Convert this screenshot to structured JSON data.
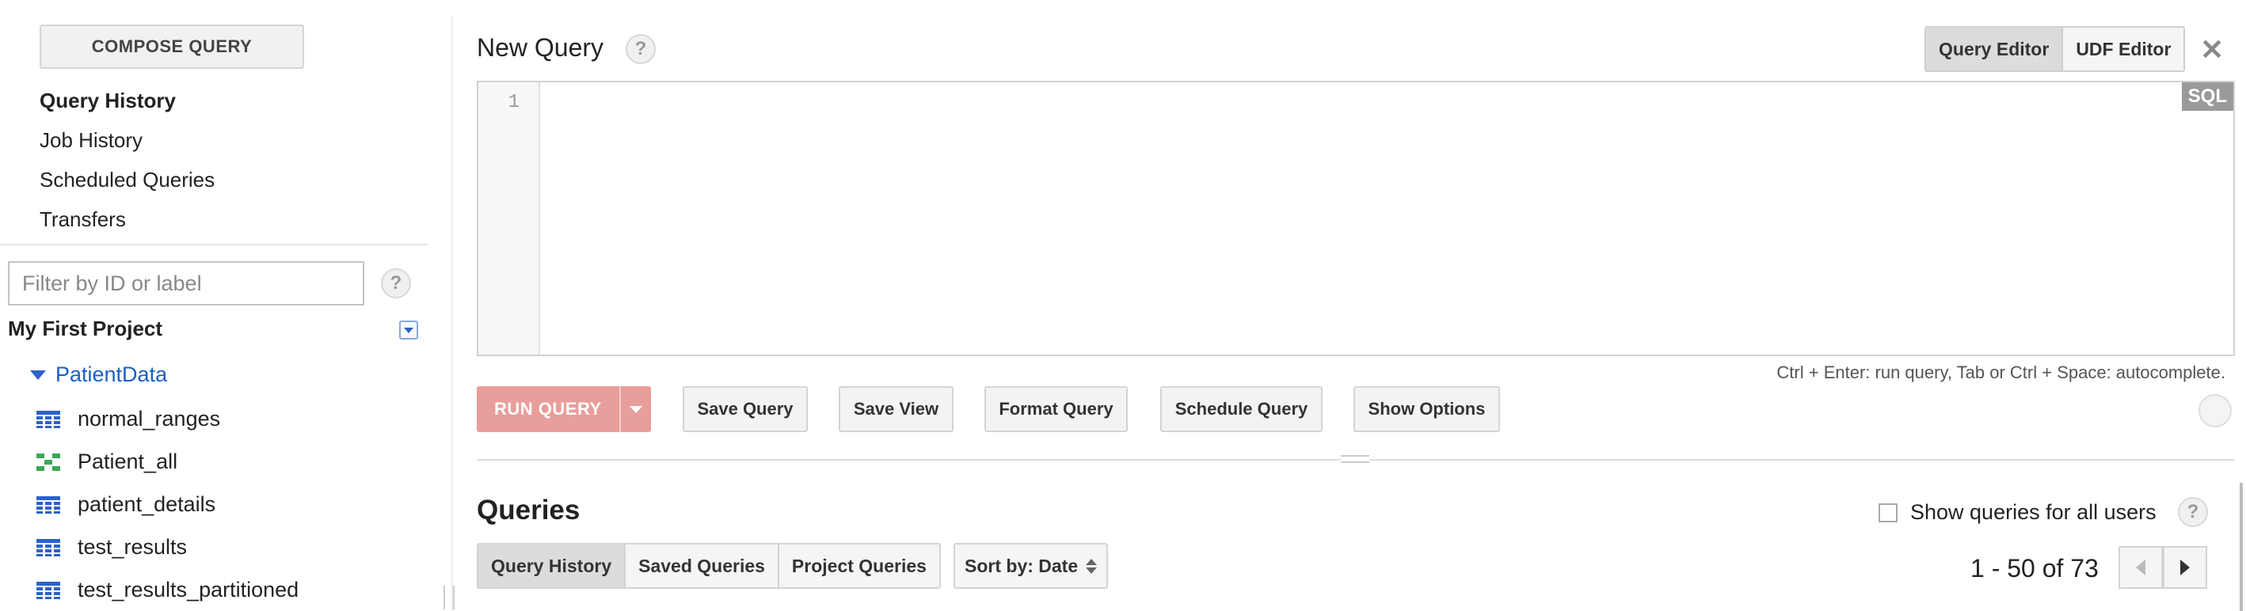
{
  "sidebar": {
    "compose_label": "COMPOSE QUERY",
    "nav": [
      "Query History",
      "Job History",
      "Scheduled Queries",
      "Transfers"
    ],
    "filter_placeholder": "Filter by ID or label",
    "help": "?",
    "project": "My First Project",
    "dataset": "PatientData",
    "tables": [
      {
        "name": "normal_ranges",
        "icon": "table-icon"
      },
      {
        "name": "Patient_all",
        "icon": "view-icon"
      },
      {
        "name": "patient_details",
        "icon": "table-icon"
      },
      {
        "name": "test_results",
        "icon": "table-icon"
      },
      {
        "name": "test_results_partitioned",
        "icon": "table-icon"
      }
    ]
  },
  "main": {
    "title": "New Query",
    "help": "?",
    "editor_toggle": [
      "Query Editor",
      "UDF Editor"
    ],
    "close": "✕",
    "line_number": "1",
    "sql_badge": "SQL",
    "hint": "Ctrl + Enter: run query, Tab or Ctrl + Space: autocomplete.",
    "run_label": "RUN QUERY",
    "buttons": [
      "Save Query",
      "Save View",
      "Format Query",
      "Schedule Query",
      "Show Options"
    ]
  },
  "queries": {
    "title": "Queries",
    "show_all_label": "Show queries for all users",
    "help": "?",
    "tabs": [
      "Query History",
      "Saved Queries",
      "Project Queries"
    ],
    "sort_label": "Sort by: Date",
    "pager": "1 - 50 of 73"
  },
  "colors": {
    "accent_blue": "#2b63c6",
    "run_button": "#e89e9a",
    "view_icon": "#3aa757"
  }
}
